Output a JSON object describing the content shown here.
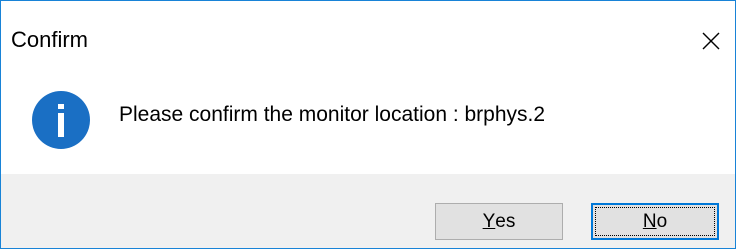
{
  "window": {
    "title": "Confirm",
    "close_icon": "close-icon",
    "accent_border": "#1883d7"
  },
  "content": {
    "icon": "info-icon",
    "icon_color": "#1a6fc4",
    "message": "Please confirm the monitor location : brphys.2"
  },
  "buttons": {
    "yes": {
      "accel": "Y",
      "rest": "es"
    },
    "no": {
      "accel": "N",
      "rest": "o",
      "focused": true
    }
  }
}
